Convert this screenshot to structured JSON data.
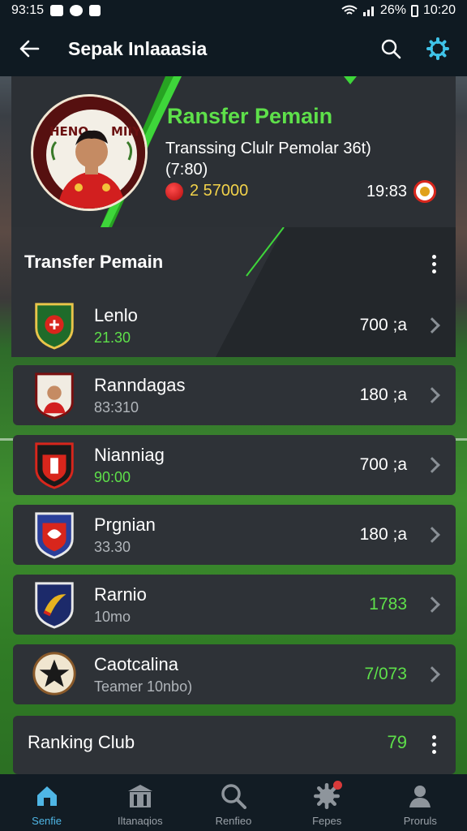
{
  "status_bar": {
    "time_left": "93:15",
    "battery": "26%",
    "time_right": "10:20"
  },
  "appbar": {
    "title": "Sepak Inlaaasia",
    "back_icon": "arrow-left-icon",
    "search_icon": "search-icon",
    "settings_icon": "gear-icon"
  },
  "hero": {
    "title": "Ransfer Pemain",
    "subtitle": "Transsing Clulr Pemolar 36t) (7:80)",
    "coins": "2 57000",
    "right_value": "19:83",
    "accent_color": "#5ee04a"
  },
  "transfer_section": {
    "title": "Transfer Pemain",
    "rows": [
      {
        "name": "Lenlo",
        "sub": "21.30",
        "sub_green": true,
        "value": "700 ;a",
        "value_green": false,
        "crest": "green-shield"
      },
      {
        "name": "Ranndagas",
        "sub": "83:310",
        "sub_green": false,
        "value": "180 ;a",
        "value_green": false,
        "crest": "player-crest"
      },
      {
        "name": "Nianniag",
        "sub": "90:00",
        "sub_green": true,
        "value": "700 ;a",
        "value_green": false,
        "crest": "red-shield"
      },
      {
        "name": "Prgnian",
        "sub": "33.30",
        "sub_green": false,
        "value": "180 ;a",
        "value_green": false,
        "crest": "blue-shield"
      },
      {
        "name": "Rarnio",
        "sub": "10mo",
        "sub_green": false,
        "value": "1783",
        "value_green": true,
        "crest": "navy-shield"
      },
      {
        "name": "Caotcalina",
        "sub": "Teamer 10nbo)",
        "sub_green": false,
        "value": "7/073",
        "value_green": true,
        "crest": "star-badge"
      }
    ]
  },
  "ranking": {
    "title": "Ranking Club",
    "value": "79"
  },
  "bottom_nav": [
    {
      "label": "Senfie",
      "icon": "home-icon",
      "active": true
    },
    {
      "label": "Iltanaqios",
      "icon": "building-icon",
      "active": false
    },
    {
      "label": "Renfieo",
      "icon": "search-icon",
      "active": false
    },
    {
      "label": "Fepes",
      "icon": "gear-badge-icon",
      "active": false
    },
    {
      "label": "Proruls",
      "icon": "profile-icon",
      "active": false
    }
  ]
}
